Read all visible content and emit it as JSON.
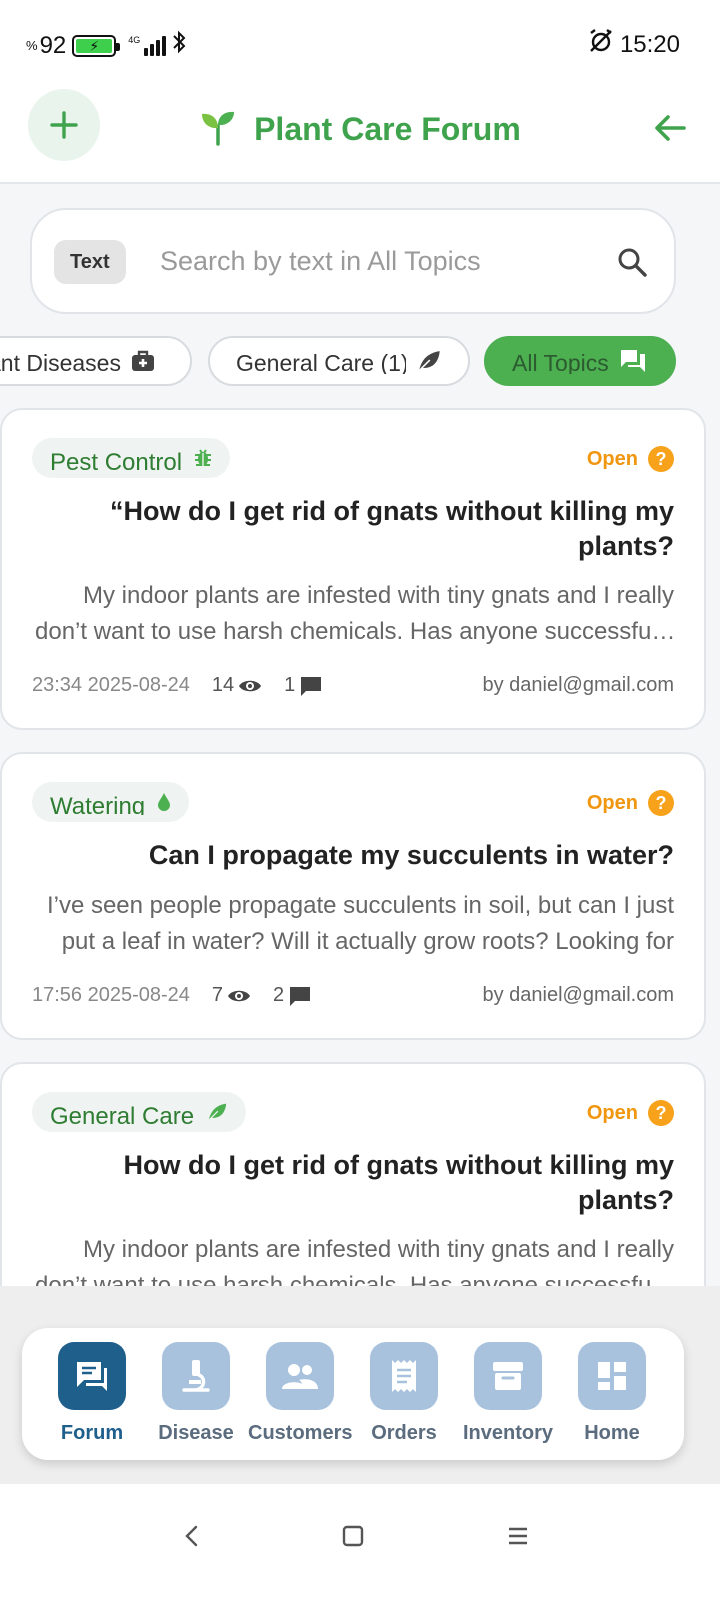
{
  "status_bar": {
    "battery_percent_prefix": "%",
    "battery_percent": "92",
    "network": "4G",
    "time": "15:20"
  },
  "header": {
    "title": "Plant Care Forum",
    "title_icon": "sprout-icon"
  },
  "search": {
    "mode_chip": "Text",
    "placeholder": "Search by text in All Topics"
  },
  "filters": [
    {
      "label": "ant Diseases",
      "icon": "first-aid-kit-icon",
      "active": false
    },
    {
      "label": "General Care (1)",
      "icon": "leaf-icon",
      "active": false
    },
    {
      "label": "All Topics",
      "icon": "chat-bubbles-icon",
      "active": true
    }
  ],
  "posts": [
    {
      "tag": "Pest Control",
      "tag_icon": "bug-icon",
      "status": "Open",
      "title": "“How do I get rid of gnats without killing my plants?",
      "body": "My indoor plants are infested with tiny gnats and I really don’t want to use harsh chemicals. Has anyone successfully dealt with them?",
      "timestamp": "23:34 2025-08-24",
      "views": "14",
      "comments": "1",
      "author": "by daniel@gmail.com"
    },
    {
      "tag": "Watering",
      "tag_icon": "water-drop-icon",
      "status": "Open",
      "title": "Can I propagate my succulents in water?",
      "body": "I’ve seen people propagate succulents in soil, but can I just put a leaf in water? Will it actually grow roots? Looking for advice.",
      "timestamp": "17:56 2025-08-24",
      "views": "7",
      "comments": "2",
      "author": "by daniel@gmail.com"
    },
    {
      "tag": "General Care",
      "tag_icon": "leaf-icon",
      "status": "Open",
      "title": "How do I get rid of gnats without killing my plants?",
      "body": "My indoor plants are infested with tiny gnats and I really don’t want to use harsh chemicals. Has anyone successfully dealt with them?",
      "timestamp": "",
      "views": "",
      "comments": "",
      "author": ""
    }
  ],
  "bottom_nav": [
    {
      "label": "Forum",
      "icon": "forum-icon",
      "active": true
    },
    {
      "label": "Disease",
      "icon": "microscope-icon",
      "active": false
    },
    {
      "label": "Customers",
      "icon": "people-icon",
      "active": false
    },
    {
      "label": "Orders",
      "icon": "receipt-icon",
      "active": false
    },
    {
      "label": "Inventory",
      "icon": "archive-box-icon",
      "active": false
    },
    {
      "label": "Home",
      "icon": "dashboard-icon",
      "active": false
    }
  ],
  "colors": {
    "brand_green": "#3fa34d",
    "active_chip": "#4caf50",
    "open_status": "#f0960f",
    "nav_active": "#1e5f8c",
    "nav_inactive": "#a8c2de"
  }
}
